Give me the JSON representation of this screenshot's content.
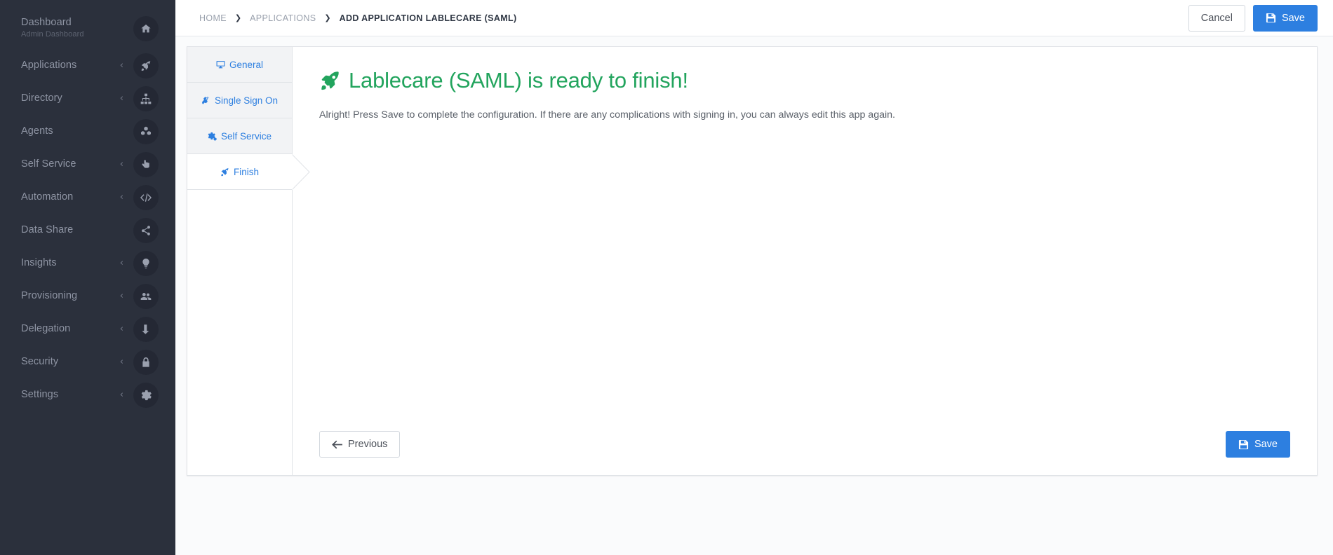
{
  "sidebar": {
    "items": [
      {
        "label": "Dashboard",
        "sub": "Admin Dashboard",
        "icon": "home-icon",
        "caret": false
      },
      {
        "label": "Applications",
        "sub": "",
        "icon": "rocket-icon",
        "caret": true
      },
      {
        "label": "Directory",
        "sub": "",
        "icon": "sitemap-icon",
        "caret": true
      },
      {
        "label": "Agents",
        "sub": "",
        "icon": "cubes-icon",
        "caret": false
      },
      {
        "label": "Self Service",
        "sub": "",
        "icon": "hand-pointer-icon",
        "caret": true
      },
      {
        "label": "Automation",
        "sub": "",
        "icon": "code-icon",
        "caret": true
      },
      {
        "label": "Data Share",
        "sub": "",
        "icon": "share-icon",
        "caret": false
      },
      {
        "label": "Insights",
        "sub": "",
        "icon": "lightbulb-icon",
        "caret": true
      },
      {
        "label": "Provisioning",
        "sub": "",
        "icon": "users-icon",
        "caret": true
      },
      {
        "label": "Delegation",
        "sub": "",
        "icon": "level-down-icon",
        "caret": true
      },
      {
        "label": "Security",
        "sub": "",
        "icon": "lock-icon",
        "caret": true
      },
      {
        "label": "Settings",
        "sub": "",
        "icon": "gear-icon",
        "caret": true
      }
    ],
    "caret_glyph": "‹"
  },
  "topbar": {
    "breadcrumb": [
      {
        "label": "HOME",
        "active": false
      },
      {
        "label": "APPLICATIONS",
        "active": false
      },
      {
        "label": "ADD APPLICATION LABLECARE (SAML)",
        "active": true
      }
    ],
    "separator": "❯",
    "cancel_label": "Cancel",
    "save_label": "Save"
  },
  "wizard": {
    "tabs": [
      {
        "label": "General",
        "icon": "desktop-icon",
        "active": false
      },
      {
        "label": "Single Sign On",
        "icon": "plug-icon",
        "active": false
      },
      {
        "label": "Self Service",
        "icon": "cogs-icon",
        "active": false
      },
      {
        "label": "Finish",
        "icon": "rocket-icon",
        "active": true
      }
    ],
    "heading": "Lablecare (SAML) is ready to finish!",
    "heading_icon": "rocket-icon",
    "body_text": "Alright! Press Save to complete the configuration. If there are any complications with signing in, you can always edit this app again.",
    "previous_label": "Previous",
    "save_label": "Save"
  },
  "colors": {
    "sidebar_bg": "#2b303c",
    "accent_blue": "#2d7fe0",
    "success_green": "#22a45d",
    "page_bg": "#fafbfc"
  }
}
